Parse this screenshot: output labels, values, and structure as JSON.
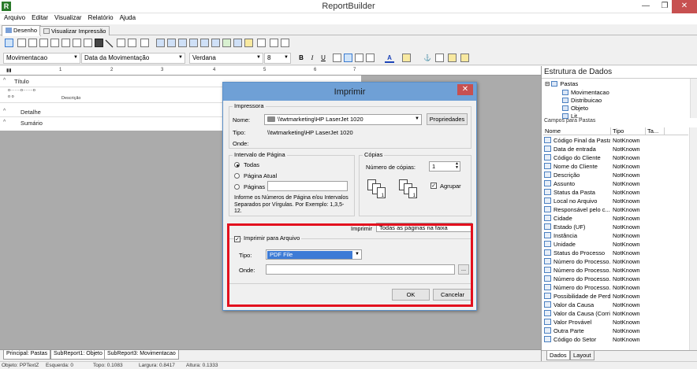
{
  "window": {
    "title": "ReportBuilder",
    "app_icon": "R",
    "minimize": "—",
    "restore": "❐",
    "close": "✕"
  },
  "menu": [
    "Arquivo",
    "Editar",
    "Visualizar",
    "Relatório",
    "Ajuda"
  ],
  "top_tabs": [
    "Desenho",
    "Visualizar Impressão"
  ],
  "toolbar2": {
    "dataset": "Movimentacao",
    "field": "Data da Movimentação",
    "font": "Verdana",
    "size": "8",
    "bold": "B",
    "italic": "I",
    "underline": "U"
  },
  "ruler": [
    "1",
    "2",
    "3",
    "4",
    "5",
    "6",
    "7"
  ],
  "bands": {
    "titulo": "Título",
    "descricao": "Descrição",
    "detalhe": "Detalhe",
    "sumario": "Sumário"
  },
  "bottom_tabs": [
    "Principal: Pastas",
    "SubReport1: Objeto",
    "SubReport3: Movimentacao"
  ],
  "status": {
    "objeto": "Objeto: PPTextZ",
    "esquerda": "Esquerda: 0",
    "topo": "Topo: 0.1083",
    "largura": "Largura: 0.8417",
    "altura": "Altura: 0.1333"
  },
  "data_panel": {
    "title": "Estrutura de Dados",
    "tree": [
      "Pastas",
      "Movimentacao",
      "Distribuicao",
      "Objeto",
      "Lit..."
    ],
    "campos_label": "Campos para Pastas",
    "headers": [
      "Nome",
      "Tipo",
      "Ta..."
    ],
    "fields": [
      {
        "name": "Código Final da Pasta",
        "type": "NotKnown"
      },
      {
        "name": "Data de entrada",
        "type": "NotKnown"
      },
      {
        "name": "Código do Cliente",
        "type": "NotKnown"
      },
      {
        "name": "Nome do Cliente",
        "type": "NotKnown"
      },
      {
        "name": "Descrição",
        "type": "NotKnown"
      },
      {
        "name": "Assunto",
        "type": "NotKnown"
      },
      {
        "name": "Status da Pasta",
        "type": "NotKnown"
      },
      {
        "name": "Local no Arquivo",
        "type": "NotKnown"
      },
      {
        "name": "Responsável pelo c...",
        "type": "NotKnown"
      },
      {
        "name": "Cidade",
        "type": "NotKnown"
      },
      {
        "name": "Estado (UF)",
        "type": "NotKnown"
      },
      {
        "name": "Instância",
        "type": "NotKnown"
      },
      {
        "name": "Unidade",
        "type": "NotKnown"
      },
      {
        "name": "Status do Processo",
        "type": "NotKnown"
      },
      {
        "name": "Número do Processo...",
        "type": "NotKnown"
      },
      {
        "name": "Número do Processo...",
        "type": "NotKnown"
      },
      {
        "name": "Número do Processo...",
        "type": "NotKnown"
      },
      {
        "name": "Número do Processo...",
        "type": "NotKnown"
      },
      {
        "name": "Possibilidade de Perda",
        "type": "NotKnown"
      },
      {
        "name": "Valor da Causa",
        "type": "NotKnown"
      },
      {
        "name": "Valor da Causa (Corri...",
        "type": "NotKnown"
      },
      {
        "name": "Valor Provável",
        "type": "NotKnown"
      },
      {
        "name": "Outra Parte",
        "type": "NotKnown"
      },
      {
        "name": "Código do Setor",
        "type": "NotKnown"
      }
    ],
    "tabs": [
      "Dados",
      "Layout"
    ]
  },
  "dialog": {
    "title": "Imprimir",
    "close": "✕",
    "impressora": {
      "group": "Impressora",
      "nome_label": "Nome:",
      "nome_value": "\\\\twtmarketing\\HP LaserJet 1020",
      "propriedades": "Propriedades",
      "tipo_label": "Tipo:",
      "tipo_value": "\\\\twtmarketing\\HP LaserJet 1020",
      "onde_label": "Onde:"
    },
    "intervalo": {
      "group": "Intervalo de Página",
      "todas": "Todas",
      "pagina_atual": "Página Atual",
      "paginas": "Páginas",
      "info": "Informe os Números de Página e/ou Intervalos Separados por Vírgulas. Por Exemplo: 1,3,5-12."
    },
    "copias": {
      "group": "Cópias",
      "numero_label": "Número de cópias:",
      "numero_value": "1",
      "agrupar": "Agrupar"
    },
    "imprimir_label": "Imprimir",
    "imprimir_value": "Todas as páginas na faixa",
    "arquivo": {
      "check_label": "Imprimir para Arquivo",
      "tipo_label": "Tipo:",
      "tipo_value": "PDF File",
      "onde_label": "Onde:",
      "browse": "..."
    },
    "ok": "OK",
    "cancelar": "Cancelar"
  },
  "colors": {
    "highlight": "#e3101e",
    "dialog_title": "#6fa0d6",
    "selection": "#3d7bd6"
  }
}
